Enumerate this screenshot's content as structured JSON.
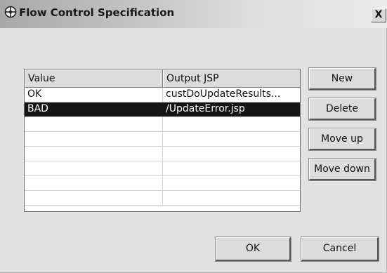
{
  "window": {
    "title": "Flow Control Specification",
    "title_icon": "flow-control-icon",
    "close_label": "X"
  },
  "table": {
    "columns": [
      "Value",
      "Output JSP"
    ],
    "rows": [
      {
        "value": "OK",
        "output": "custDoUpdateResults...",
        "selected": false
      },
      {
        "value": "BAD",
        "output": "/UpdateError.jsp",
        "selected": true
      },
      {
        "value": "",
        "output": "",
        "selected": false
      },
      {
        "value": "",
        "output": "",
        "selected": false
      },
      {
        "value": "",
        "output": "",
        "selected": false
      },
      {
        "value": "",
        "output": "",
        "selected": false
      },
      {
        "value": "",
        "output": "",
        "selected": false
      },
      {
        "value": "",
        "output": "",
        "selected": false
      }
    ]
  },
  "buttons": {
    "new": "New",
    "delete": "Delete",
    "move_up": "Move up",
    "move_down": "Move down",
    "ok": "OK",
    "cancel": "Cancel"
  },
  "colors": {
    "selection_bg": "#141414",
    "selection_fg": "#ffffff",
    "dialog_bg": "#e2e2e2"
  }
}
